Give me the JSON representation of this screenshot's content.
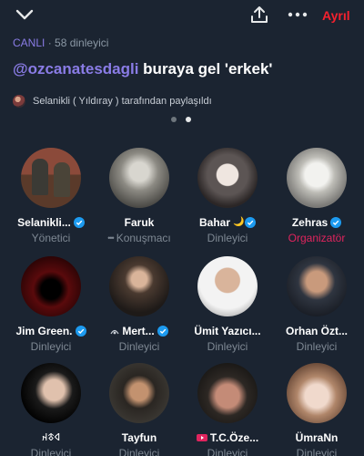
{
  "topbar": {
    "collapse_icon": "chevron-down-icon",
    "share_icon": "share-icon",
    "more_icon": "more-horizontal-icon",
    "leave_label": "Ayrıl"
  },
  "status": {
    "live": "CANLI",
    "separator": "·",
    "listeners": "58 dinleyici"
  },
  "space": {
    "host_handle": "@ozcanatesdagli",
    "title_rest": " buraya gel 'erkek'"
  },
  "shared_by": "Selanikli ( Yıldıray ) tarafından paylaşıldı",
  "pager": {
    "count": 2,
    "active": 1
  },
  "participants": [
    {
      "name": "Selanikli...",
      "verified": true,
      "role": "Yönetici"
    },
    {
      "name": "Faruk",
      "verified": false,
      "role": "Konuşmacı",
      "speaking": true
    },
    {
      "name": "Bahar",
      "verified": true,
      "name_emoji": "🌙",
      "role": "Dinleyici"
    },
    {
      "name": "Zehras",
      "verified": true,
      "role": "Organizatör",
      "role_color": "#e0245e"
    },
    {
      "name": "Jim Green.",
      "verified": true,
      "role": "Dinleyici"
    },
    {
      "name": "Mert...",
      "verified": true,
      "name_prefix_icon": "spaces-icon",
      "role": "Dinleyici"
    },
    {
      "name": "Ümit Yazıcı...",
      "verified": false,
      "role": "Dinleyici"
    },
    {
      "name": "Orhan Özt...",
      "verified": false,
      "role": "Dinleyici"
    },
    {
      "name": "𐰶𐱃𐰴",
      "verified": false,
      "role": "Dinleyici"
    },
    {
      "name": "Tayfun",
      "verified": false,
      "role": "Dinleyici"
    },
    {
      "name": "T.C.Öze...",
      "verified": false,
      "name_prefix_icon": "youtube-icon",
      "role": "Dinleyici"
    },
    {
      "name": "ÜmraNn",
      "verified": false,
      "role": "Dinleyici"
    }
  ],
  "colors": {
    "background": "#1b2431",
    "accent": "#8a7ce6",
    "verified": "#1d9bf0",
    "leave": "#f4212e",
    "muted": "#7e8893"
  }
}
